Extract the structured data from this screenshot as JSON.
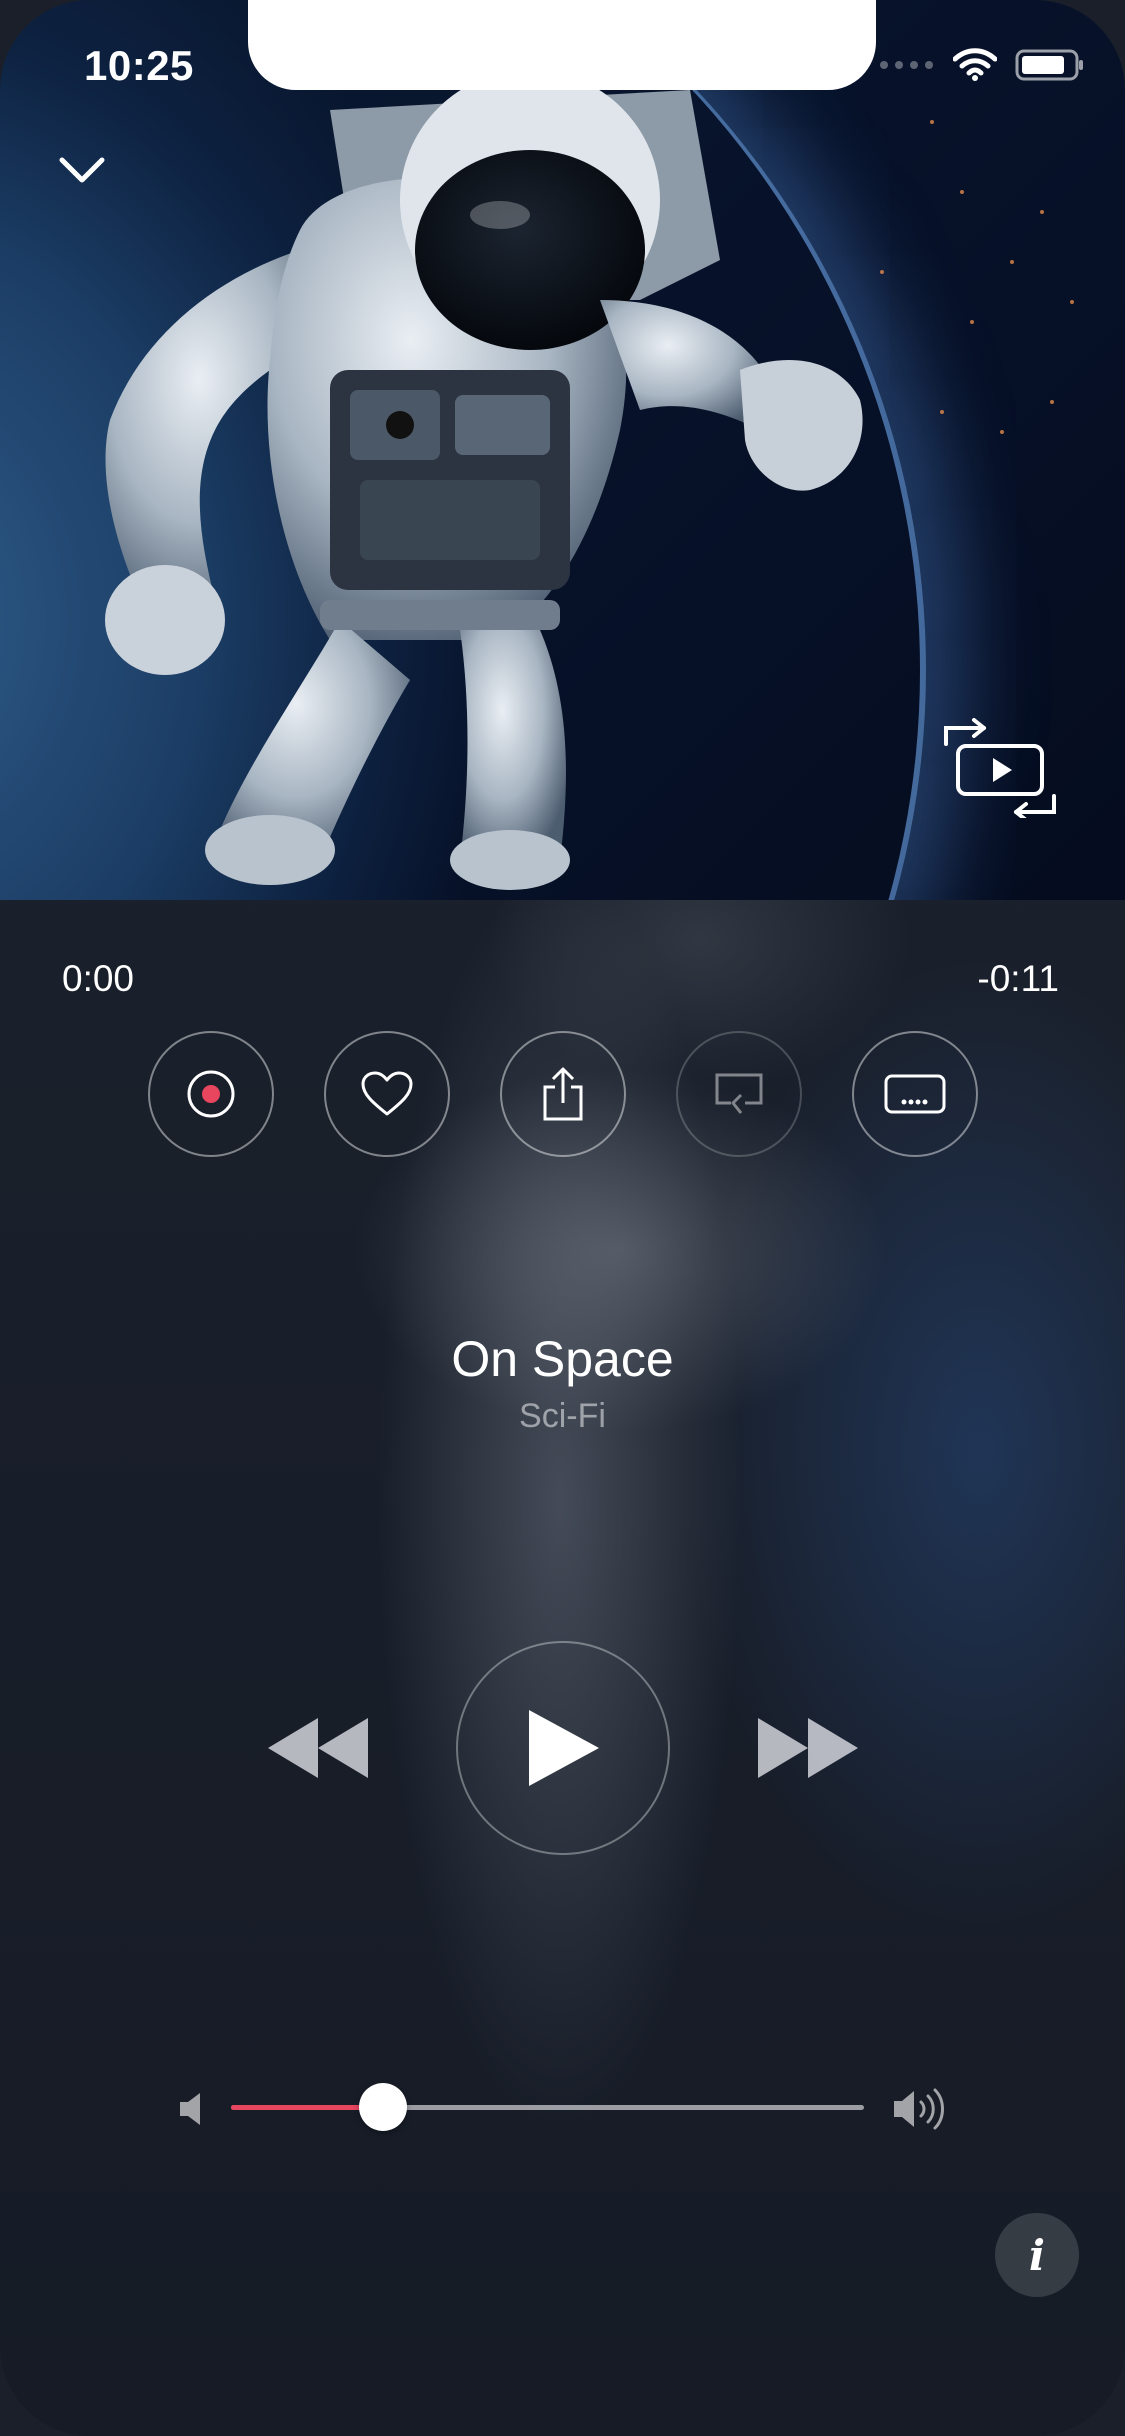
{
  "status_bar": {
    "time": "10:25"
  },
  "player": {
    "time_elapsed": "0:00",
    "time_remaining": "-0:11",
    "title": "On Space",
    "genre": "Sci-Fi",
    "volume_level": 0.24
  },
  "actions": [
    {
      "name": "record",
      "icon": "record-icon"
    },
    {
      "name": "favorite",
      "icon": "heart-icon"
    },
    {
      "name": "share",
      "icon": "share-icon"
    },
    {
      "name": "reply",
      "icon": "reply-icon"
    },
    {
      "name": "subtitles",
      "icon": "subtitles-icon"
    }
  ],
  "info_button": {
    "label": "i"
  },
  "colors": {
    "accent": "#e8455f",
    "background": "#1a202b",
    "record_dot": "#e8455f"
  }
}
